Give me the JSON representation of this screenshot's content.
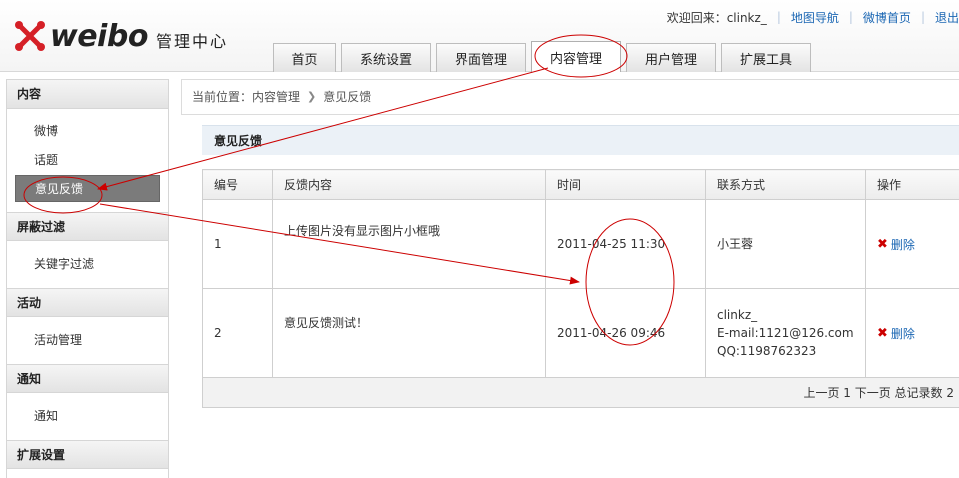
{
  "header": {
    "logo_text": "weibo",
    "logo_subtitle": "管理中心",
    "welcome": "欢迎回来：clinkz_",
    "links": [
      "地图导航",
      "微博首页",
      "退出"
    ]
  },
  "tabs": [
    {
      "label": "首页"
    },
    {
      "label": "系统设置"
    },
    {
      "label": "界面管理"
    },
    {
      "label": "内容管理"
    },
    {
      "label": "用户管理"
    },
    {
      "label": "扩展工具"
    }
  ],
  "sidebar": {
    "sections": [
      {
        "title": "内容",
        "items": [
          "微博",
          "话题",
          "意见反馈"
        ]
      },
      {
        "title": "屏蔽过滤",
        "items": [
          "关键字过滤"
        ]
      },
      {
        "title": "活动",
        "items": [
          "活动管理"
        ]
      },
      {
        "title": "通知",
        "items": [
          "通知"
        ]
      },
      {
        "title": "扩展设置",
        "items": []
      }
    ],
    "active_item": "意见反馈"
  },
  "breadcrumb": {
    "prefix": "当前位置：",
    "parent": "内容管理",
    "current": "意见反馈"
  },
  "panel": {
    "title": "意见反馈"
  },
  "table": {
    "columns": [
      "编号",
      "反馈内容",
      "时间",
      "联系方式",
      "操作"
    ],
    "rows": [
      {
        "id": "1",
        "content": "上传图片没有显示图片小框哦",
        "time": "2011-04-25 11:30",
        "contact": [
          "小王蓉"
        ],
        "action": "删除"
      },
      {
        "id": "2",
        "content": "意见反馈测试！",
        "time": "2011-04-26 09:46",
        "contact": [
          "clinkz_",
          "E-mail:1121@126.com",
          "QQ:1198762323"
        ],
        "action": "删除"
      }
    ],
    "pager": "上一页 1 下一页 总记录数 2"
  },
  "colors": {
    "link": "#1a66b3",
    "annotation": "#cc0000",
    "active_sidebar": "#7b7b7b",
    "panel_title_bg": "#ebf1f7"
  }
}
